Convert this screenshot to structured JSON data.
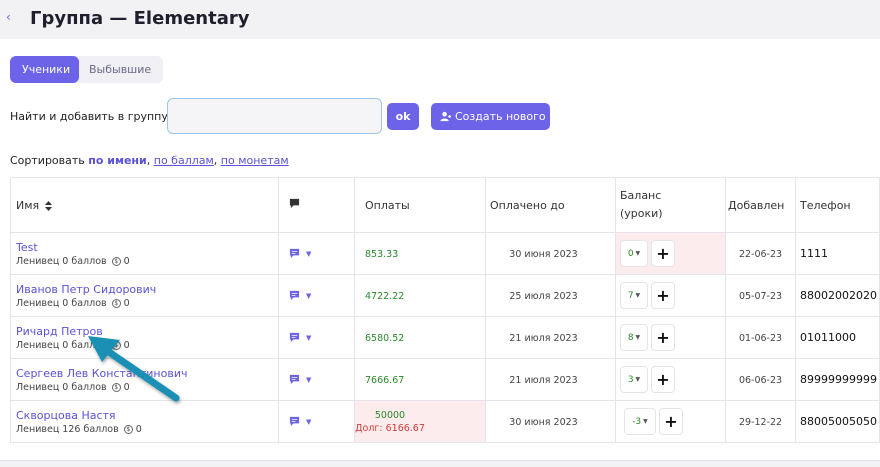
{
  "header": {
    "back": "‹",
    "title": "Группа — Elementary"
  },
  "tabs": [
    {
      "label": "Ученики",
      "active": true
    },
    {
      "label": "Выбывшие",
      "active": false
    }
  ],
  "search": {
    "label": "Найти и добавить в группу:",
    "value": "",
    "ok_label": "ok",
    "create_label": "Создать нового"
  },
  "sort": {
    "prefix": "Сортировать",
    "by_name": "по имени",
    "sep1": ",",
    "by_points": "по баллам",
    "sep2": ",",
    "by_coins": "по монетам"
  },
  "table": {
    "headers": {
      "name": "Имя",
      "payments": "Оплаты",
      "paid_until": "Оплачено до",
      "balance_line1": "Баланс",
      "balance_line2": "(уроки)",
      "added": "Добавлен",
      "phone": "Телефон"
    },
    "rows": [
      {
        "name": "Test",
        "sub": "Ленивец 0 баллов",
        "coins": "0",
        "payment": "853.33",
        "debt": "",
        "paid_until": "30 июня 2023",
        "balance": "0",
        "added": "22-06-23",
        "phone": "1111",
        "pink_balance": true,
        "pink_payment": false
      },
      {
        "name": "Иванов Петр Сидорович",
        "sub": "Ленивец 0 баллов",
        "coins": "0",
        "payment": "4722.22",
        "debt": "",
        "paid_until": "25 июля 2023",
        "balance": "7",
        "added": "05-07-23",
        "phone": "88002002020",
        "pink_balance": false,
        "pink_payment": false
      },
      {
        "name": "Ричард Петров",
        "sub": "Ленивец 0 баллов",
        "coins": "0",
        "payment": "6580.52",
        "debt": "",
        "paid_until": "21 июля 2023",
        "balance": "8",
        "added": "01-06-23",
        "phone": "01011000",
        "pink_balance": false,
        "pink_payment": false
      },
      {
        "name": "Сергеев Лев Константинович",
        "sub": "Ленивец 0 баллов",
        "coins": "0",
        "payment": "7666.67",
        "debt": "",
        "paid_until": "21 июля 2023",
        "balance": "3",
        "added": "06-06-23",
        "phone": "89999999999",
        "pink_balance": false,
        "pink_payment": false
      },
      {
        "name": "Скворцова Настя",
        "sub": "Ленивец 126 баллов",
        "coins": "0",
        "payment": "50000",
        "debt": "Долг: 6166.67",
        "paid_until": "30 июня 2023",
        "balance": "-3",
        "added": "29-12-22",
        "phone": "88005005050",
        "pink_balance": false,
        "pink_payment": true
      }
    ]
  },
  "colors": {
    "accent": "#6c63e8",
    "link": "#5a52d6",
    "positive": "#2a8a2a",
    "debt": "#d23a3a",
    "highlight": "#fdeced",
    "annotation_arrow": "#1e8fb5"
  },
  "icons": {
    "back": "chevron-left-icon",
    "sort": "sort-icon",
    "message": "chat-icon",
    "coin": "coin-icon",
    "add_user": "add-user-icon",
    "plus": "plus-icon"
  }
}
